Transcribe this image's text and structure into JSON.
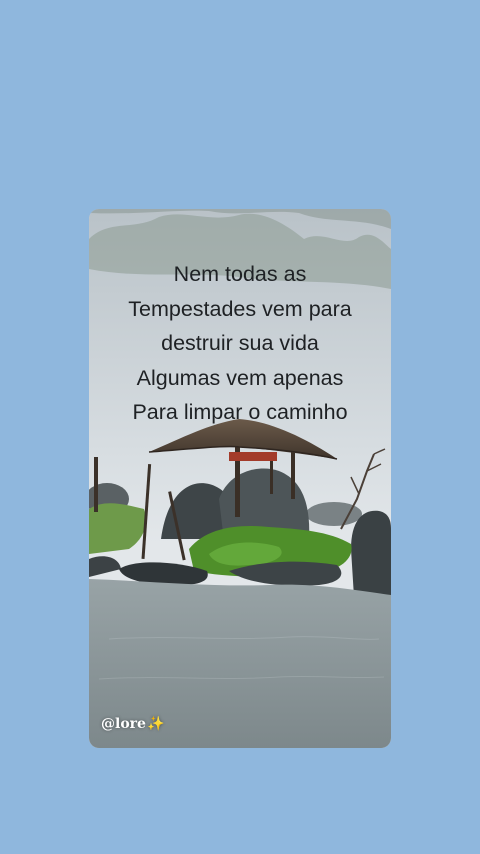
{
  "background_color": "#8fb7dd",
  "story": {
    "quote_lines": [
      "Nem todas as",
      "Tempestades vem para",
      "destruir sua vida",
      "Algumas vem apenas",
      "Para limpar o caminho"
    ],
    "handle": "@lore",
    "handle_icon": "sparkles-icon",
    "handle_icon_glyph": "✨"
  }
}
